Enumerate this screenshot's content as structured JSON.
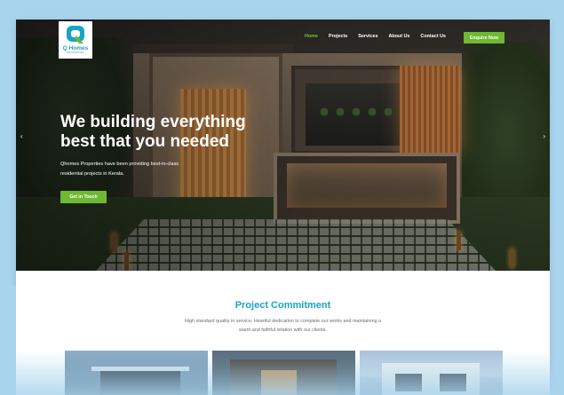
{
  "brand": {
    "name": "Q Homes",
    "tagline": "PROPERTIES",
    "accent": "#6fb932",
    "primary": "#1aa3c6"
  },
  "nav": {
    "items": [
      {
        "label": "Home",
        "active": true
      },
      {
        "label": "Projects"
      },
      {
        "label": "Services"
      },
      {
        "label": "About Us"
      },
      {
        "label": "Contact Us"
      }
    ],
    "enquire_label": "Enquire Now"
  },
  "hero": {
    "title_line1": "We building everything",
    "title_line2": "best that you needed",
    "description_line1": "Qhomes Properties have been providing best-in-class",
    "description_line2": "residential projects in Kerala.",
    "cta_label": "Get in Touch",
    "prev_icon": "chevron-left-icon",
    "next_icon": "chevron-right-icon"
  },
  "commitment": {
    "title": "Project Commitment",
    "text_line1": "High standard quality in service, Heartful dedication to complete our works and maintaining a",
    "text_line2": "warm and faithful relation with our clients."
  }
}
